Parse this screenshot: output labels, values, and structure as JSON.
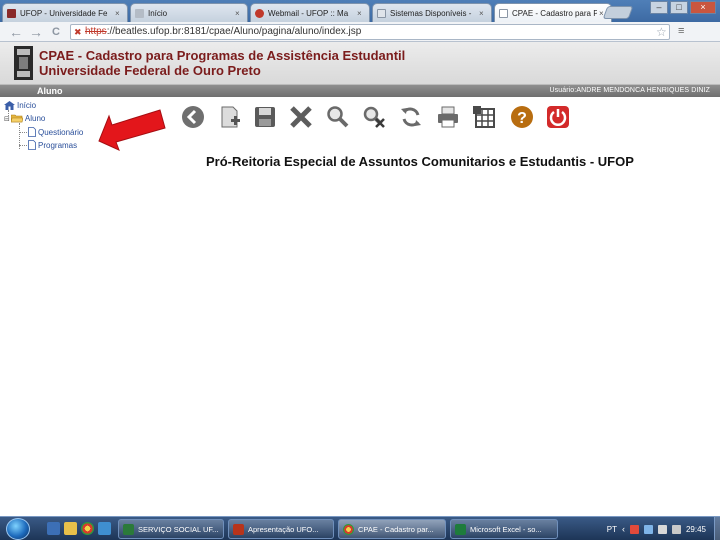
{
  "browser": {
    "tabs": [
      {
        "title": "UFOP - Universidade Fe",
        "close": "×",
        "favicon_color": "#8a2a2a",
        "active": false
      },
      {
        "title": "Início",
        "close": "×",
        "favicon_color": "#b4bcc6",
        "active": false
      },
      {
        "title": "Webmail - UFOP :: Ma",
        "close": "×",
        "favicon_color": "#c0392b",
        "active": false
      },
      {
        "title": "Sistemas Disponíveis - ",
        "close": "×",
        "favicon_color": "#dfe4ea",
        "active": false
      },
      {
        "title": "CPAE - Cadastro para P",
        "close": "×",
        "favicon_color": "#ffffff",
        "active": true
      }
    ],
    "window_buttons": {
      "minimize": "–",
      "maximize": "□",
      "close": "×"
    },
    "address": {
      "protocol": "https",
      "rest": "://beatles.ufop.br:8181/cpae/Aluno/pagina/aluno/index.jsp"
    },
    "nav": {
      "back": "←",
      "forward": "→",
      "reload": "C"
    },
    "star": "☆",
    "menu": "≡"
  },
  "app": {
    "title": "CPAE - Cadastro para Programas de Assistência Estudantil",
    "subtitle": "Universidade Federal de Ouro Preto",
    "role": "Aluno",
    "user": "Usuário:ANDRE MENDONCA HENRIQUES DINIZ",
    "heading": "Pró-Reitoria Especial de Assuntos Comunitarios e Estudantis - UFOP"
  },
  "tree": {
    "root": "Início",
    "folder": "Aluno",
    "items": [
      "Questionário",
      "Programas"
    ]
  },
  "toolbar_icons": [
    "back-icon",
    "new-document-icon",
    "save-icon",
    "delete-icon",
    "search-icon",
    "clear-search-icon",
    "refresh-icon",
    "print-icon",
    "table-icon",
    "help-icon",
    "power-icon"
  ],
  "taskbar": {
    "tasks": [
      {
        "label": "SERVIÇO SOCIAL UF...",
        "color": "#2b7a3a",
        "active": false
      },
      {
        "label": "Apresentação UFO...",
        "color": "#b8341b",
        "active": false
      },
      {
        "label": "CPAE - Cadastro par...",
        "color": "#e0b53a",
        "active": true
      },
      {
        "label": "Microsoft Excel - so...",
        "color": "#1e7c3c",
        "active": false
      }
    ],
    "lang": "PT",
    "clock": "29:45"
  },
  "colors": {
    "app_title": "#7b1c1c",
    "arrow": "#e3161b",
    "userbar": "#7d7d7d"
  }
}
